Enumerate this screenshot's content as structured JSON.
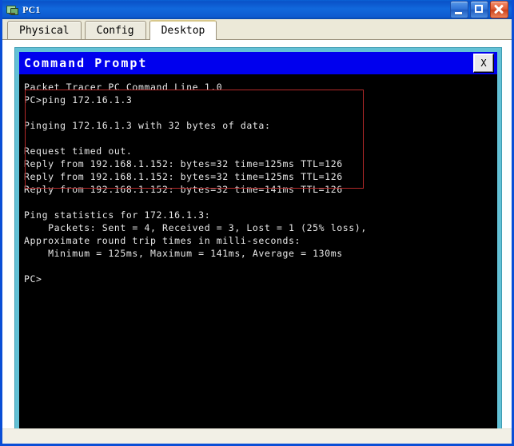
{
  "window": {
    "title": "PC1",
    "icon": "network-device-icon",
    "caption_buttons": {
      "minimize": "minimize-icon",
      "maximize": "maximize-icon",
      "close": "close-icon"
    }
  },
  "tabs": [
    {
      "label": "Physical",
      "active": false
    },
    {
      "label": "Config",
      "active": false
    },
    {
      "label": "Desktop",
      "active": true
    }
  ],
  "terminal": {
    "title": "Command Prompt",
    "close_label": "X",
    "colors": {
      "frame": "#63c1d6",
      "titlebar": "#0000ee",
      "background": "#000000",
      "text": "#e8e8e8",
      "annotation": "#b52a2a"
    },
    "lines": [
      "Packet Tracer PC Command Line 1.0",
      "PC>ping 172.16.1.3",
      "",
      "Pinging 172.16.1.3 with 32 bytes of data:",
      "",
      "Request timed out.",
      "Reply from 192.168.1.152: bytes=32 time=125ms TTL=126",
      "Reply from 192.168.1.152: bytes=32 time=125ms TTL=126",
      "Reply from 192.168.1.152: bytes=32 time=141ms TTL=126",
      "",
      "Ping statistics for 172.16.1.3:",
      "    Packets: Sent = 4, Received = 3, Lost = 1 (25% loss),",
      "Approximate round trip times in milli-seconds:",
      "    Minimum = 125ms, Maximum = 141ms, Average = 130ms",
      "",
      "PC>"
    ],
    "text": "Packet Tracer PC Command Line 1.0\nPC>ping 172.16.1.3\n\nPinging 172.16.1.3 with 32 bytes of data:\n\nRequest timed out.\nReply from 192.168.1.152: bytes=32 time=125ms TTL=126\nReply from 192.168.1.152: bytes=32 time=125ms TTL=126\nReply from 192.168.1.152: bytes=32 time=141ms TTL=126\n\nPing statistics for 172.16.1.3:\n    Packets: Sent = 4, Received = 3, Lost = 1 (25% loss),\nApproximate round trip times in milli-seconds:\n    Minimum = 125ms, Maximum = 141ms, Average = 130ms\n\nPC>",
    "ping_result": {
      "target": "172.16.1.3",
      "payload_bytes": 32,
      "responding_host": "192.168.1.152",
      "replies": [
        {
          "bytes": 32,
          "time_ms": 125,
          "ttl": 126
        },
        {
          "bytes": 32,
          "time_ms": 125,
          "ttl": 126
        },
        {
          "bytes": 32,
          "time_ms": 141,
          "ttl": 126
        }
      ],
      "timeouts": 1,
      "sent": 4,
      "received": 3,
      "lost": 1,
      "loss_percent": 25,
      "min_ms": 125,
      "max_ms": 141,
      "avg_ms": 130
    }
  }
}
